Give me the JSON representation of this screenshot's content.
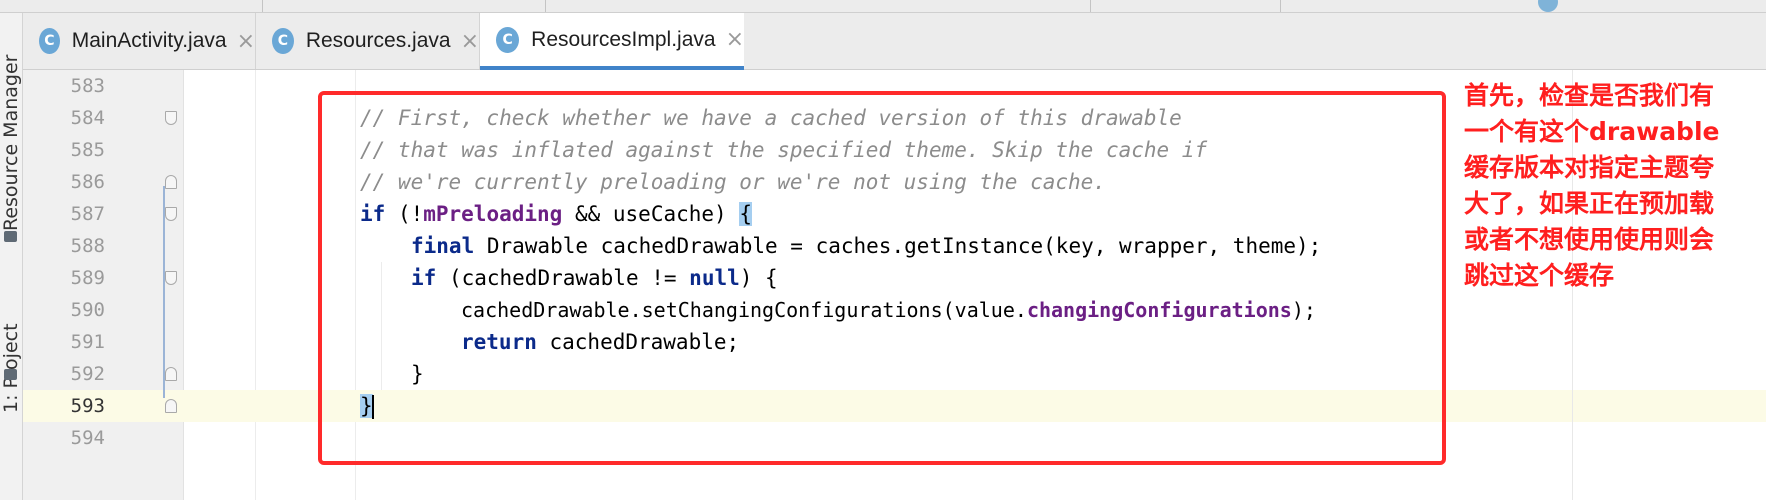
{
  "tool_windows": {
    "resource_manager_label": "Resource Manager",
    "project_label": "1: Project"
  },
  "tabs": [
    {
      "label": "MainActivity.java",
      "icon": "class-icon",
      "active": false
    },
    {
      "label": "Resources.java",
      "icon": "class-icon",
      "active": false
    },
    {
      "label": "ResourcesImpl.java",
      "icon": "class-icon",
      "active": true
    }
  ],
  "icon_glyphs": {
    "class": "C",
    "close": "×"
  },
  "editor": {
    "current_line": 593,
    "lines": [
      {
        "num": "583"
      },
      {
        "num": "584",
        "comment": "// First, check whether we have a cached version of this drawable"
      },
      {
        "num": "585",
        "comment": "// that was inflated against the specified theme. Skip the cache if"
      },
      {
        "num": "586",
        "comment": "// we're currently preloading or we're not using the cache."
      },
      {
        "num": "587",
        "kw": "if",
        "open": " (!",
        "field": "mPreloading",
        "rest": " && useCache) ",
        "brace": "{"
      },
      {
        "num": "588",
        "kw": "final",
        "rest": " Drawable cachedDrawable = caches.getInstance(key, wrapper, theme);"
      },
      {
        "num": "589",
        "kw": "if",
        "open": " (cachedDrawable != ",
        "kw2": "null",
        "rest": ") {"
      },
      {
        "num": "590",
        "pre": "cachedDrawable.setChangingConfigurations(value.",
        "field": "changingConfigurations",
        "rest": ");"
      },
      {
        "num": "591",
        "kw": "return",
        "rest": " cachedDrawable;"
      },
      {
        "num": "592",
        "rest": "}"
      },
      {
        "num": "593",
        "brace": "}"
      },
      {
        "num": "594"
      }
    ]
  },
  "annotation": {
    "lines": [
      "首先，检查是否我们有",
      "一个有这个drawable",
      "缓存版本对指定主题夸",
      "大了，如果正在预加载",
      "或者不想使用使用则会",
      "跳过这个缓存"
    ],
    "color": "#ff1f1f"
  }
}
